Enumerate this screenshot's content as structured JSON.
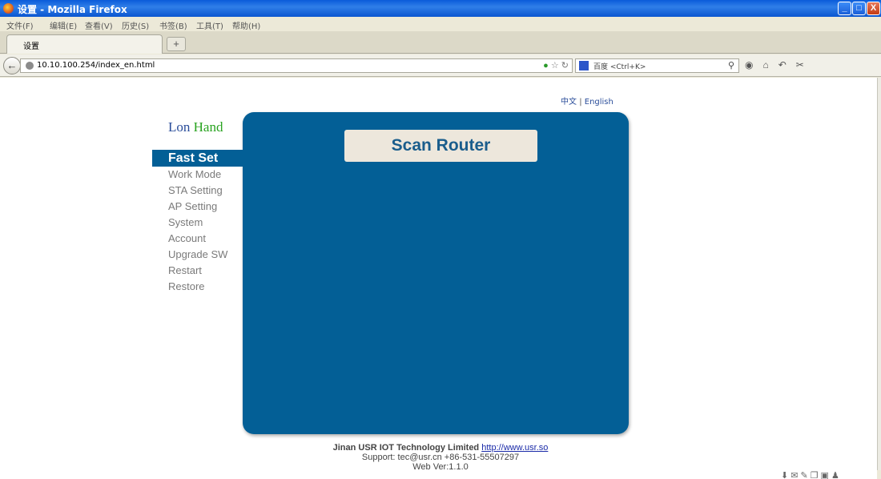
{
  "window": {
    "title": "设置 - Mozilla Firefox",
    "buttons": [
      "_",
      "□",
      "X"
    ]
  },
  "menubar": [
    "文件(F)",
    "编辑(E)",
    "查看(V)",
    "历史(S)",
    "书签(B)",
    "工具(T)",
    "帮助(H)"
  ],
  "tab": {
    "label": "设置",
    "new_tab": "+"
  },
  "nav": {
    "back": "←",
    "url": "10.10.100.254/index_en.html",
    "search_placeholder": "百度 <Ctrl+K>"
  },
  "page": {
    "lang": {
      "zh": "中文",
      "sep": "|",
      "en": "English"
    },
    "brand": {
      "part1": "Lon",
      "part2": "Hand"
    },
    "menu": [
      {
        "label": "Fast Set",
        "active": true
      },
      {
        "label": "Work Mode"
      },
      {
        "label": "STA Setting"
      },
      {
        "label": "AP Setting"
      },
      {
        "label": "System"
      },
      {
        "label": "Account"
      },
      {
        "label": "Upgrade SW"
      },
      {
        "label": "Restart"
      },
      {
        "label": "Restore"
      }
    ],
    "scan_button": "Scan Router",
    "footer": {
      "company": "Jinan USR IOT Technology Limited",
      "link": "http://www.usr.so",
      "support": "Support: tec@usr.cn +86-531-55507297",
      "version": "Web Ver:1.1.0"
    }
  },
  "colors": {
    "panel": "#035f96",
    "brand_blue": "#2a4d9a",
    "brand_green": "#29a320",
    "button_bg": "#ede7dc"
  }
}
